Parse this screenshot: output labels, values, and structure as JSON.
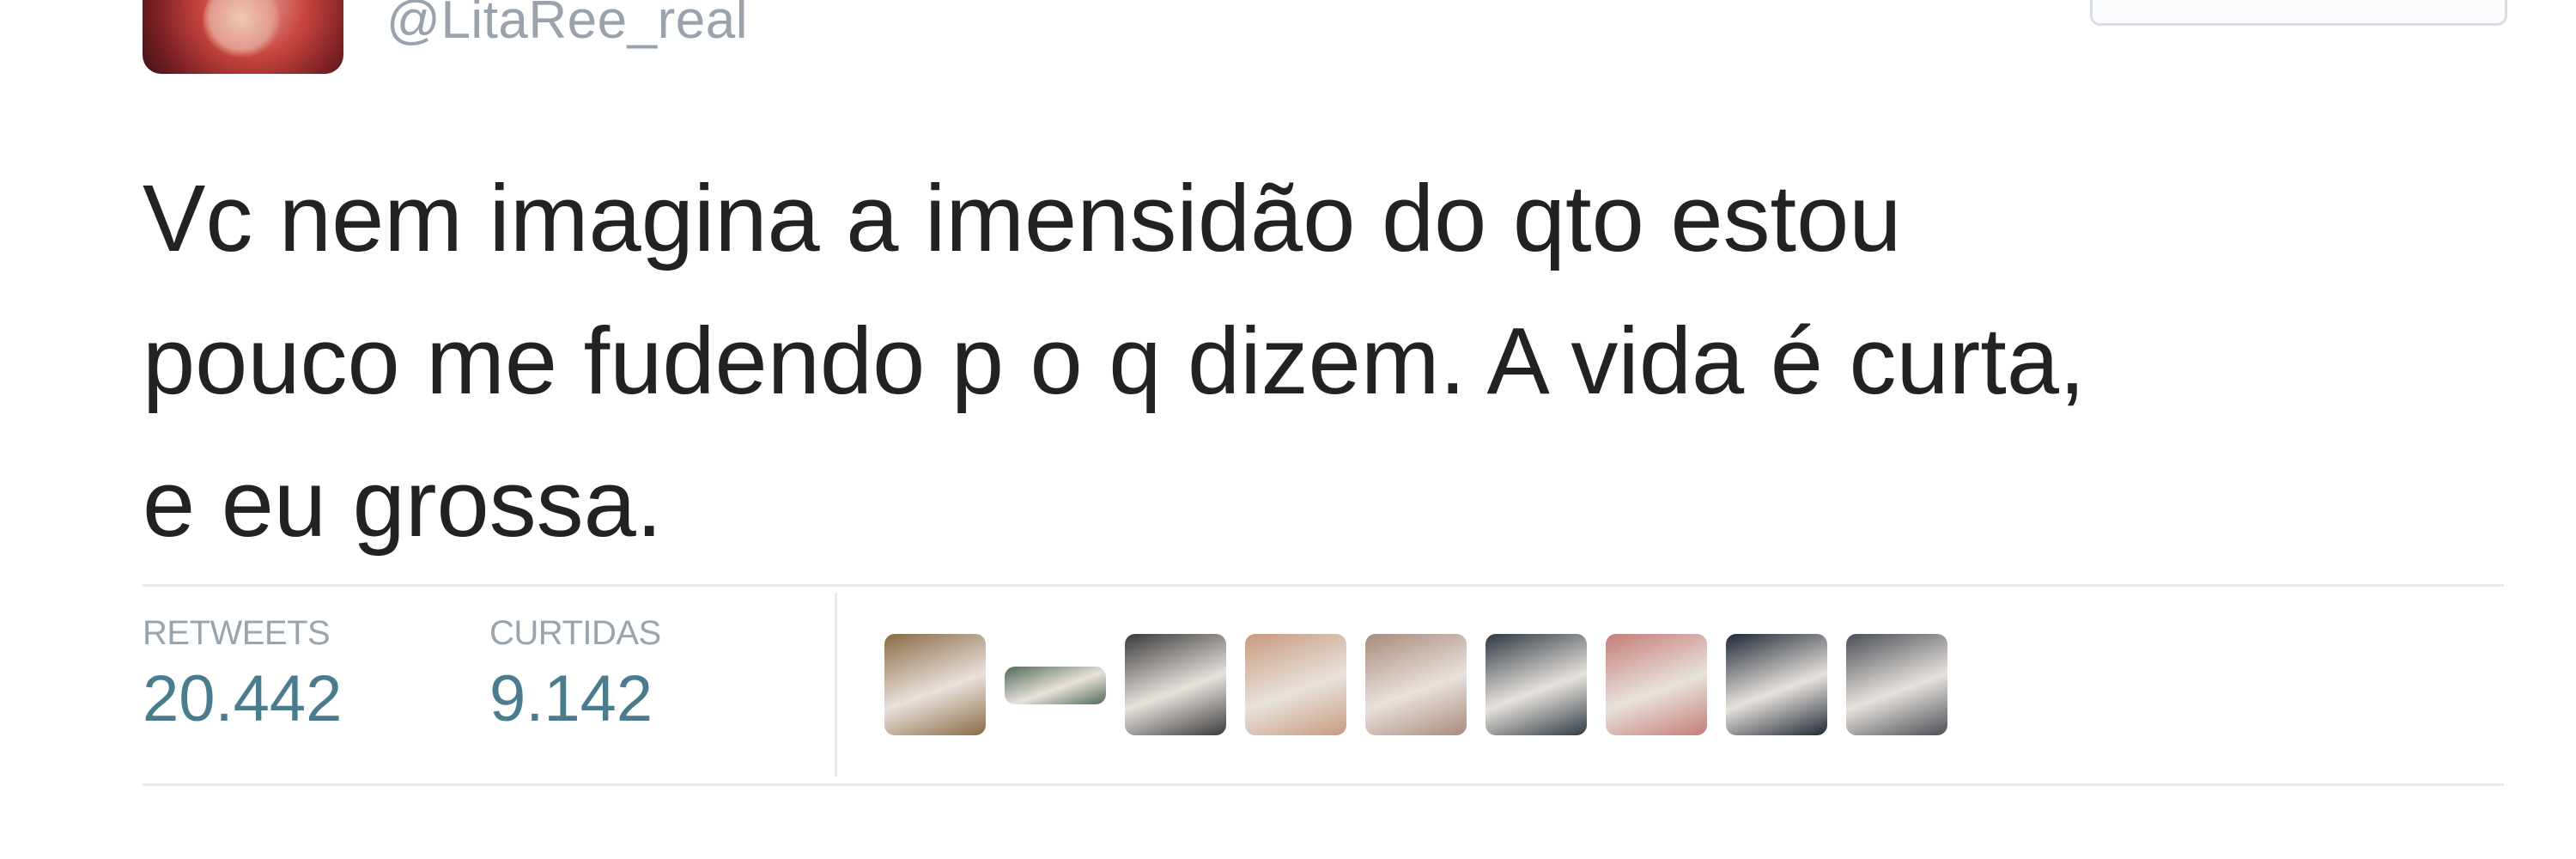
{
  "tweet": {
    "handle": "@LitaRee_real",
    "text": "Vc nem imagina a imensidão do qto estou\npouco me fudendo p o q dizem. A vida é curta,\ne eu grossa.",
    "stats": {
      "retweets_label": "RETWEETS",
      "retweets_value": "20.442",
      "likes_label": "CURTIDAS",
      "likes_value": "9.142"
    },
    "likers": [
      {
        "avatar": "dog-avatar-icon",
        "color": "#8b6a45"
      },
      {
        "avatar": "landscape-avatar-icon",
        "color": "#4f6a58"
      },
      {
        "avatar": "person-avatar-icon",
        "color": "#3b3b3b"
      },
      {
        "avatar": "person-avatar-icon",
        "color": "#c89a7e"
      },
      {
        "avatar": "person-avatar-icon",
        "color": "#a98a7c"
      },
      {
        "avatar": "person-avatar-icon",
        "color": "#2e3a44"
      },
      {
        "avatar": "person-avatar-icon",
        "color": "#c57d78"
      },
      {
        "avatar": "person-avatar-icon",
        "color": "#1f2937"
      },
      {
        "avatar": "person-avatar-icon",
        "color": "#4a4f57"
      }
    ]
  },
  "colors": {
    "text": "#222222",
    "handle": "#9aa3ad",
    "stat_label": "#99a5ae",
    "stat_value": "#4b7c8e",
    "divider": "#e6ecf0"
  }
}
